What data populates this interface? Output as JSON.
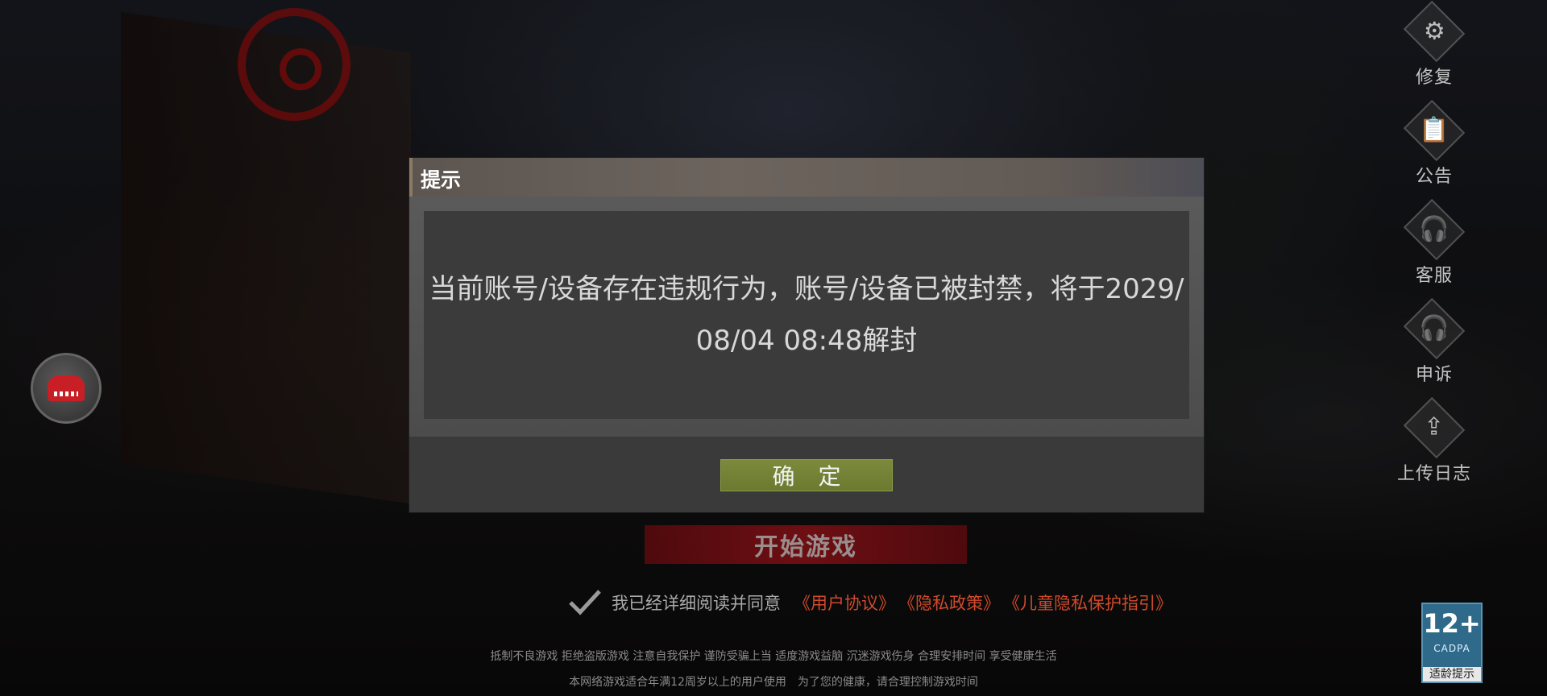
{
  "dialog": {
    "title": "提示",
    "message": "当前账号/设备存在违规行为，账号/设备已被封禁，将于2029/08/04 08:48解封",
    "confirm_label": "确 定"
  },
  "start_button_label": "开始游戏",
  "agreement": {
    "text": "我已经详细阅读并同意",
    "links": [
      "《用户协议》",
      "《隐私政策》",
      "《儿童隐私保护指引》"
    ]
  },
  "side_menu": [
    {
      "label": "修复",
      "icon": "gears-icon"
    },
    {
      "label": "公告",
      "icon": "notice-icon"
    },
    {
      "label": "客服",
      "icon": "headset-icon"
    },
    {
      "label": "申诉",
      "icon": "appeal-icon"
    },
    {
      "label": "上传日志",
      "icon": "upload-icon"
    }
  ],
  "footer": {
    "line1": "抵制不良游戏 拒绝盗版游戏 注意自我保护 谨防受骗上当 适度游戏益脑 沉迷游戏伤身 合理安排时间 享受健康生活",
    "line2": "本网络游戏适合年满12周岁以上的用户使用　为了您的健康，请合理控制游戏时间"
  },
  "age_badge": {
    "rating": "12+",
    "org": "CADPA",
    "tip": "适龄提示"
  },
  "colors": {
    "confirm_button": "#748334",
    "link": "#d04a2c",
    "start_button": "#7a0e14"
  }
}
